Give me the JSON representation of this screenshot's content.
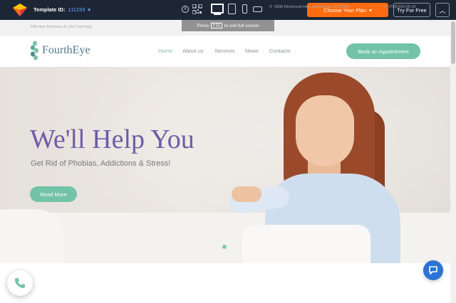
{
  "toolbar": {
    "template_label": "Template ID:",
    "template_id": "111233",
    "choose_plan": "Choose Your Plan",
    "try_free": "Try For Free",
    "fullscreen_tip_before": "Press",
    "fullscreen_tip_key": "F11",
    "fullscreen_tip_after": "to exit full screen"
  },
  "infobar": {
    "tagline": "Effective Business & Life Coaching",
    "address": "4336 Richmond Hwy, Alexandria, VA 22303",
    "phone": "(703)329-06-32"
  },
  "header": {
    "brand": "FourthEye",
    "nav": [
      "Home",
      "About us",
      "Services",
      "News",
      "Contacts"
    ],
    "active_nav": "Home",
    "cta": "Book an Appointment"
  },
  "hero": {
    "title": "We'll Help You",
    "subtitle": "Get Rid of Phobias, Addictions & Stress!",
    "button": "Read More",
    "slides": 3,
    "active_slide": 2
  },
  "colors": {
    "toolbar_bg": "#1d2635",
    "accent_orange": "#ff6b0f",
    "accent_green": "#72c3a7",
    "title_purple": "#6e5ca6",
    "chat_blue": "#2d73d6"
  },
  "icons": [
    "logo-icon",
    "info-icon",
    "qr-icon",
    "desktop-icon",
    "tablet-icon",
    "mobile-icon",
    "landscape-icon",
    "chevron-up-icon",
    "map-pin-icon",
    "phone-icon",
    "leaf-logo-icon",
    "chat-icon",
    "call-icon"
  ]
}
